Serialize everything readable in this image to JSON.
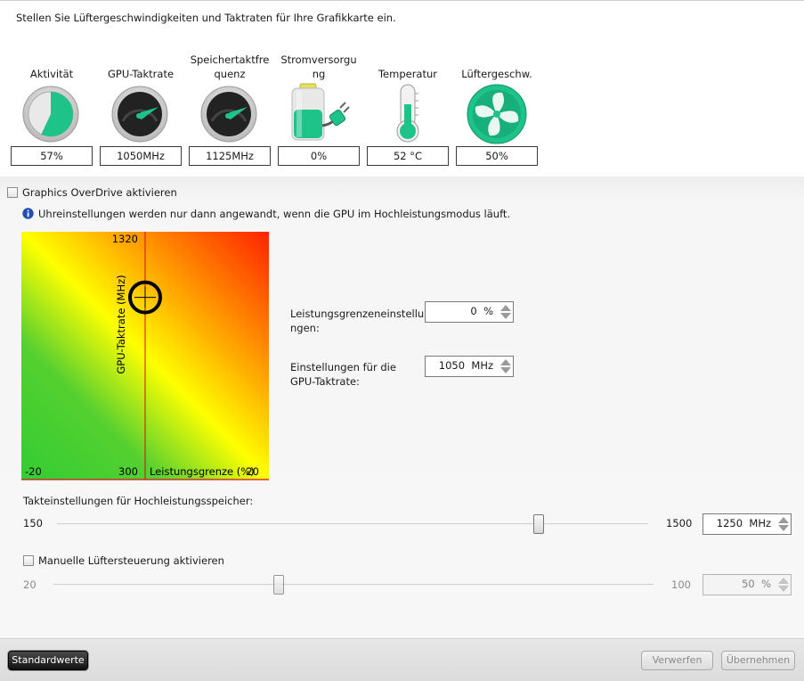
{
  "header": {
    "instruction": "Stellen Sie Lüftergeschwindigkeiten und Taktraten für Ihre Grafikkarte ein."
  },
  "gauges": [
    {
      "label": "Aktivität",
      "value": "57%",
      "icon": "activity-pie-icon",
      "fraction": 0.57
    },
    {
      "label": "GPU-Taktrate",
      "value": "1050MHz",
      "icon": "speedometer-icon"
    },
    {
      "label": "Speichertaktfre quenz",
      "value": "1125MHz",
      "icon": "speedometer-icon"
    },
    {
      "label": "Stromversorgu ng",
      "value": "0%",
      "icon": "battery-plug-icon"
    },
    {
      "label": "Temperatur",
      "value": "52 °C",
      "icon": "thermometer-icon"
    },
    {
      "label": "Lüftergeschw.",
      "value": "50%",
      "icon": "fan-icon"
    }
  ],
  "overdrive": {
    "checkbox_label": "Graphics OverDrive aktivieren",
    "checked": false,
    "info_text": "Uhreinstellungen werden nur dann angewandt, wenn die GPU im Hochleistungsmodus läuft."
  },
  "chart_data": {
    "type": "scatter",
    "x": [
      0
    ],
    "y": [
      1050
    ],
    "xlim": [
      -20,
      20
    ],
    "ylim": [
      300,
      1320
    ],
    "xlabel": "Leistungsgrenze (%)",
    "ylabel": "GPU-Taktrate (MHz)",
    "tick_labels": {
      "x_min": "-20",
      "x_max": "20",
      "y_min": "300",
      "y_max": "1320"
    },
    "gradient_colors": [
      "#33cc33",
      "#ffff00",
      "#ff2200"
    ]
  },
  "power_limit": {
    "label": "Leistungsgrenzeneinstellu ngen:",
    "value": "0",
    "unit": "%"
  },
  "gpu_clock": {
    "label": "Einstellungen für die GPU-Taktrate:",
    "value": "1050",
    "unit": "MHz"
  },
  "memory_clock": {
    "label": "Takteinstellungen für Hochleistungsspeicher:",
    "min": "150",
    "max": "1500",
    "value": "1250",
    "unit": "MHz"
  },
  "fan_control": {
    "checkbox_label": "Manuelle Lüftersteuerung aktivieren",
    "checked": false,
    "min": "20",
    "max": "100",
    "value": "50",
    "unit": "%"
  },
  "footer": {
    "defaults_button": "Standardwerte",
    "discard_button": "Verwerfen",
    "apply_button": "Übernehmen"
  },
  "colors": {
    "accent_green": "#1ec38a",
    "dark_button": "#1a1a1a"
  }
}
